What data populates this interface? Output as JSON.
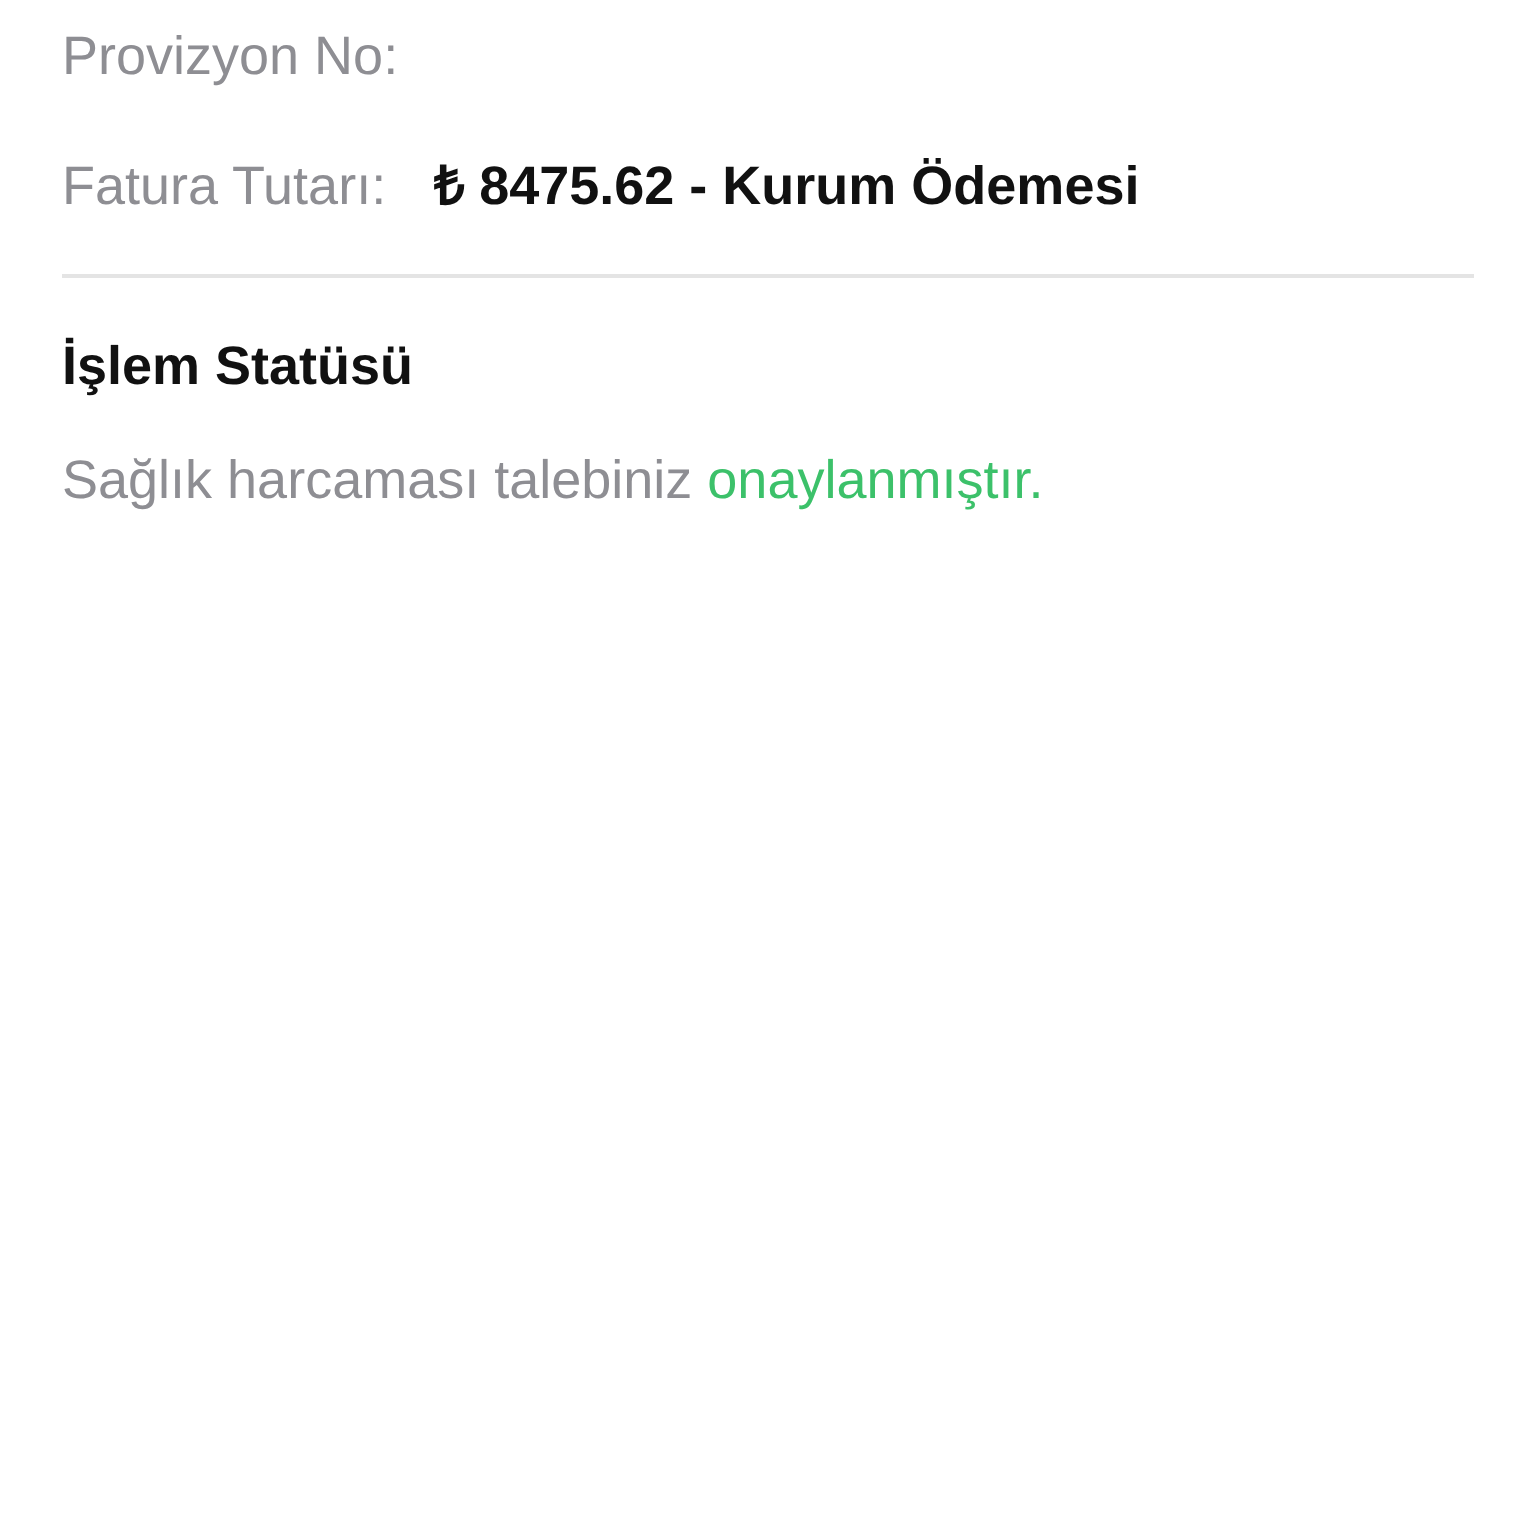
{
  "details": [
    {
      "label": "Provizyon No:"
    },
    {
      "label": "Fatura Tutarı:",
      "value": "₺ 8475.62 - Kurum Ödemesi"
    }
  ],
  "status": {
    "title": "İşlem Statüsü",
    "message": "Sağlık harcaması talebiniz",
    "result": "onaylanmıştır."
  }
}
